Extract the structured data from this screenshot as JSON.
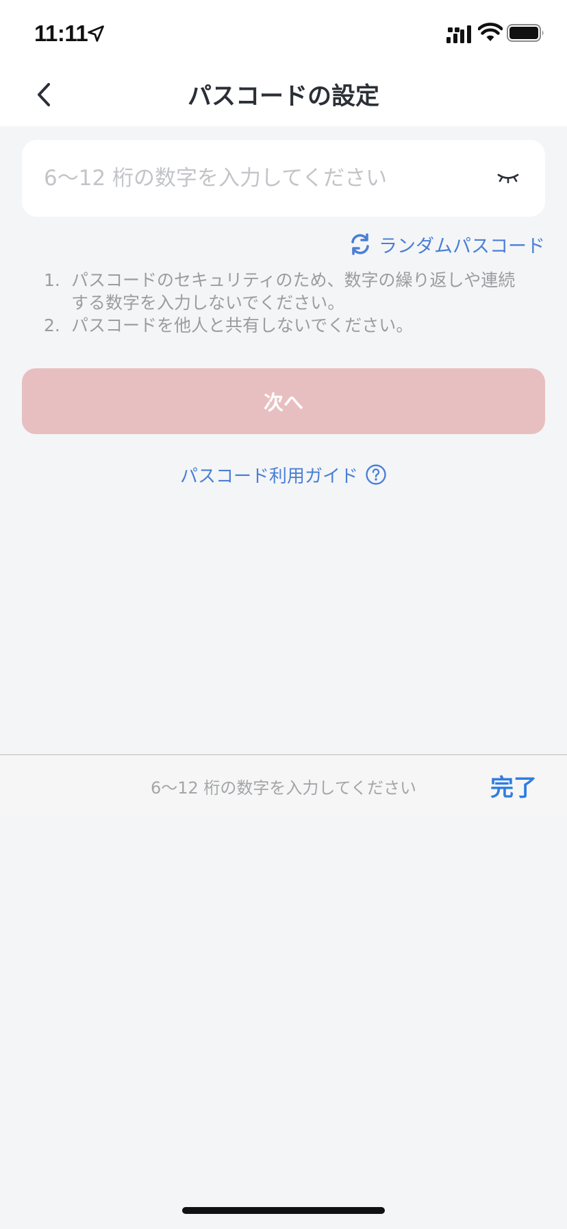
{
  "status_bar": {
    "time": "11:11",
    "icons": [
      "location-arrow-icon",
      "signal-icon",
      "wifi-icon",
      "battery-icon"
    ]
  },
  "nav": {
    "title": "パスコードの設定",
    "back_icon": "chevron-left-icon"
  },
  "passcode": {
    "placeholder": "6～12 桁の数字を入力してください",
    "value": "",
    "toggle_icon": "eye-closed-icon"
  },
  "random_link": {
    "label": "ランダムパスコード",
    "icon": "refresh-icon"
  },
  "notes": [
    {
      "num": "1.",
      "text": "パスコードのセキュリティのため、数字の繰り返しや連続する数字を入力しないでください。"
    },
    {
      "num": "2.",
      "text": "パスコードを他人と共有しないでください。"
    }
  ],
  "next_button": {
    "label": "次へ",
    "color": "#e8bfc1"
  },
  "guide_link": {
    "label": "パスコード利用ガイド",
    "icon": "question-circle-icon"
  },
  "keyboard_toolbar": {
    "hint": "6～12 桁の数字を入力してください",
    "done_label": "完了"
  },
  "colors": {
    "accent": "#4a7fd6",
    "done": "#2f7de1",
    "background": "#f4f5f6"
  }
}
